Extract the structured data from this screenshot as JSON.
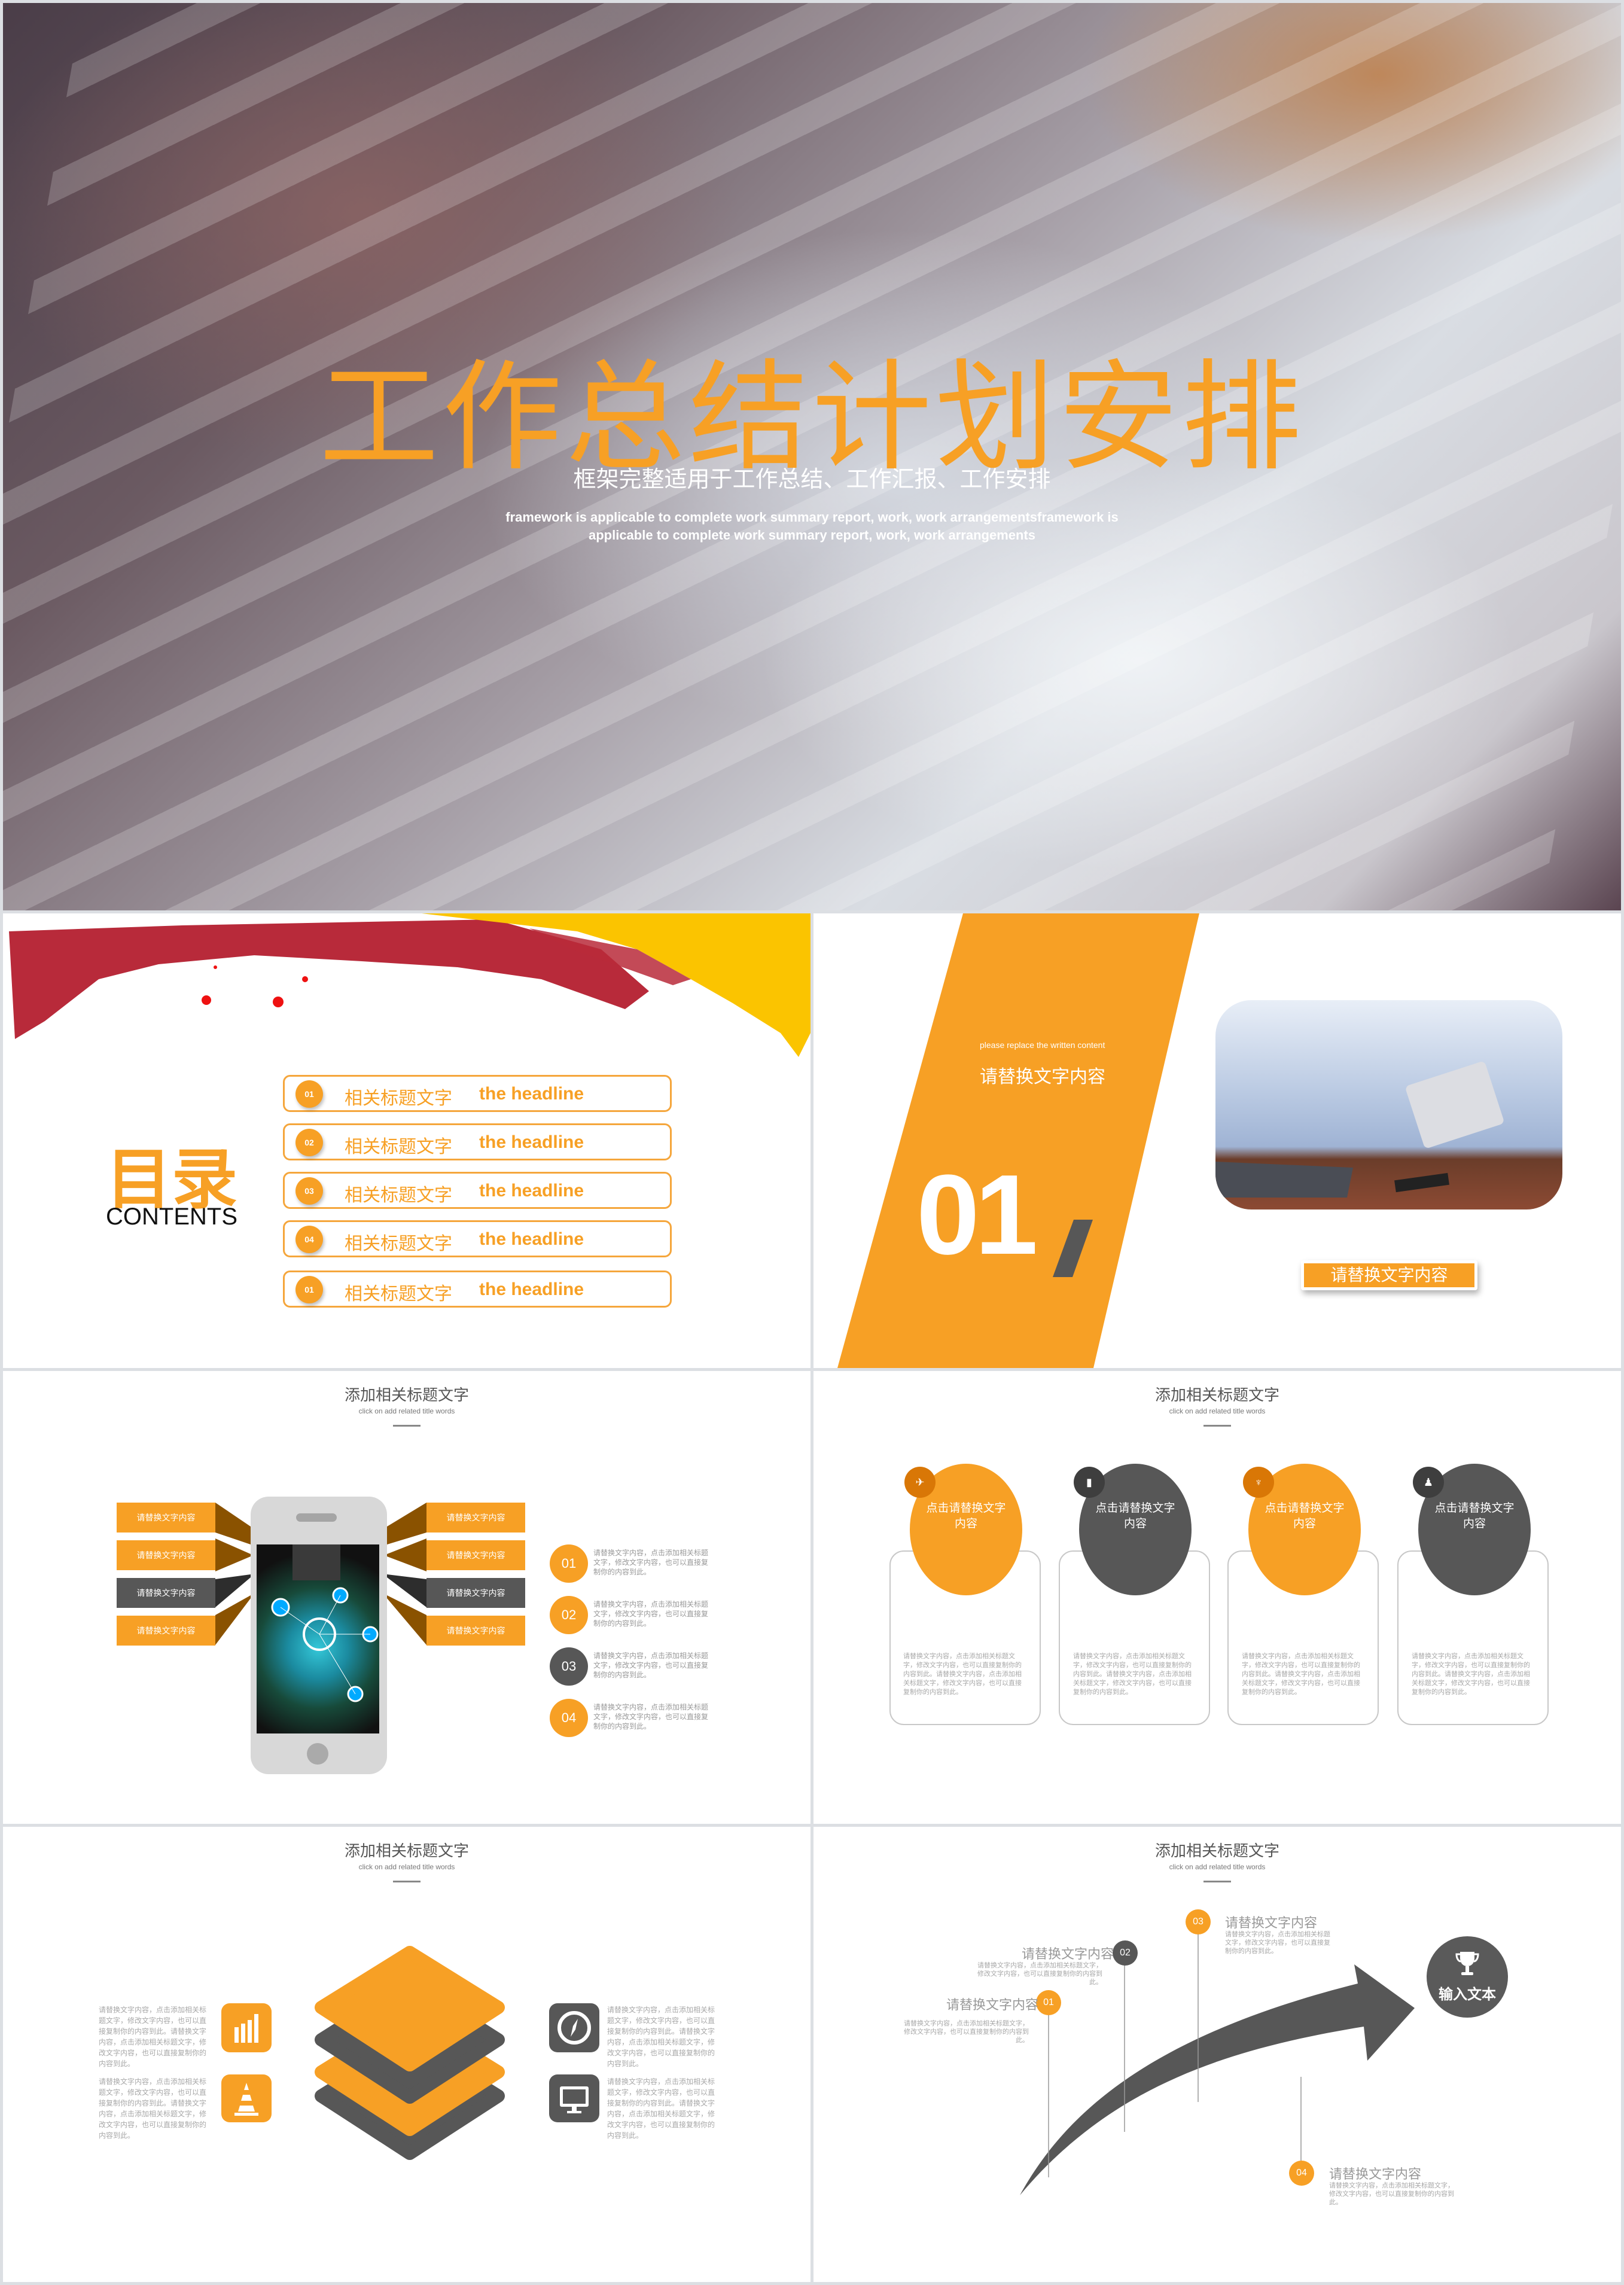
{
  "colors": {
    "orange": "#f7a025",
    "dark_orange": "#8a5200",
    "gray": "#575757",
    "dark_gray": "#333333",
    "light_gray_text": "#a8a8a8"
  },
  "hero": {
    "title": "工作总结计划安排",
    "subtitle": "框架完整适用于工作总结、工作汇报、工作安排",
    "en_line1": "framework is applicable to complete work summary report, work, work arrangementsframework is",
    "en_line2": "applicable to complete work summary report, work, work arrangements"
  },
  "toc": {
    "title": "目录",
    "title_en": "CONTENTS",
    "items": [
      {
        "num": "01",
        "label": "相关标题文字",
        "label_en": "the headline"
      },
      {
        "num": "02",
        "label": "相关标题文字",
        "label_en": "the headline"
      },
      {
        "num": "03",
        "label": "相关标题文字",
        "label_en": "the headline"
      },
      {
        "num": "04",
        "label": "相关标题文字",
        "label_en": "the headline"
      },
      {
        "num": "01",
        "label": "相关标题文字",
        "label_en": "the headline"
      }
    ]
  },
  "section": {
    "small": "please replace the written content",
    "heading": "请替换文字内容",
    "number": "01",
    "button": "请替换文字内容",
    "photo_icon": "man-with-tablet-photo"
  },
  "header": {
    "title": "添加相关标题文字",
    "subtitle": "click on add related title words"
  },
  "phone_slide": {
    "left_boxes": [
      "请替换文字内容",
      "请替换文字内容",
      "请替换文字内容",
      "请替换文字内容"
    ],
    "right_boxes": [
      "请替换文字内容",
      "请替换文字内容",
      "请替换文字内容",
      "请替换文字内容"
    ],
    "points": [
      {
        "num": "01",
        "text": "请替换文字内容，点击添加相关标题文字，修改文字内容，也可以直接复制你的内容到此。"
      },
      {
        "num": "02",
        "text": "请替换文字内容，点击添加相关标题文字，修改文字内容，也可以直接复制你的内容到此。"
      },
      {
        "num": "03",
        "text": "请替换文字内容，点击添加相关标题文字，修改文字内容，也可以直接复制你的内容到此。"
      },
      {
        "num": "04",
        "text": "请替换文字内容，点击添加相关标题文字，修改文字内容，也可以直接复制你的内容到此。"
      }
    ]
  },
  "circles_slide": {
    "cards": [
      {
        "label": "点击请替换文字内容",
        "icon": "paper-plane-icon",
        "glyph": "✈",
        "text": "请替换文字内容，点击添加相关标题文字，修改文字内容，也可以直接复制你的内容到此。请替换文字内容，点击添加相关标题文字，修改文字内容，也可以直接复制你的内容到此。"
      },
      {
        "label": "点击请替换文字内容",
        "icon": "clipboard-icon",
        "glyph": "▮",
        "text": "请替换文字内容，点击添加相关标题文字，修改文字内容，也可以直接复制你的内容到此。请替换文字内容，点击添加相关标题文字，修改文字内容，也可以直接复制你的内容到此。"
      },
      {
        "label": "点击请替换文字内容",
        "icon": "hierarchy-icon",
        "glyph": "♆",
        "text": "请替换文字内容，点击添加相关标题文字，修改文字内容，也可以直接复制你的内容到此。请替换文字内容，点击添加相关标题文字，修改文字内容，也可以直接复制你的内容到此。"
      },
      {
        "label": "点击请替换文字内容",
        "icon": "user-icon",
        "glyph": "♟",
        "text": "请替换文字内容，点击添加相关标题文字，修改文字内容，也可以直接复制你的内容到此。请替换文字内容，点击添加相关标题文字，修改文字内容，也可以直接复制你的内容到此。"
      }
    ]
  },
  "layers_slide": {
    "blocks": [
      {
        "icon": "bar-chart-icon",
        "text": "请替换文字内容，点击添加相关标题文字，修改文字内容，也可以直接复制你的内容到此。请替换文字内容，点击添加相关标题文字，修改文字内容，也可以直接复制你的内容到此。"
      },
      {
        "icon": "traffic-cone-icon",
        "text": "请替换文字内容，点击添加相关标题文字，修改文字内容，也可以直接复制你的内容到此。请替换文字内容，点击添加相关标题文字，修改文字内容，也可以直接复制你的内容到此。"
      },
      {
        "icon": "compass-icon",
        "text": "请替换文字内容，点击添加相关标题文字，修改文字内容，也可以直接复制你的内容到此。请替换文字内容，点击添加相关标题文字，修改文字内容，也可以直接复制你的内容到此。"
      },
      {
        "icon": "monitor-icon",
        "text": "请替换文字内容，点击添加相关标题文字，修改文字内容，也可以直接复制你的内容到此。请替换文字内容，点击添加相关标题文字，修改文字内容，也可以直接复制你的内容到此。"
      }
    ]
  },
  "arrow_slide": {
    "goal": "输入文本",
    "steps": [
      {
        "num": "01",
        "heading": "请替换文字内容",
        "text": "请替换文字内容，点击添加相关标题文字，修改文字内容，也可以直接复制你的内容到此。"
      },
      {
        "num": "02",
        "heading": "请替换文字内容",
        "text": "请替换文字内容，点击添加相关标题文字，修改文字内容，也可以直接复制你的内容到此。"
      },
      {
        "num": "03",
        "heading": "请替换文字内容",
        "text": "请替换文字内容，点击添加相关标题文字，修改文字内容，也可以直接复制你的内容到此。"
      },
      {
        "num": "04",
        "heading": "请替换文字内容",
        "text": "请替换文字内容，点击添加相关标题文字，修改文字内容，也可以直接复制你的内容到此。"
      }
    ]
  }
}
